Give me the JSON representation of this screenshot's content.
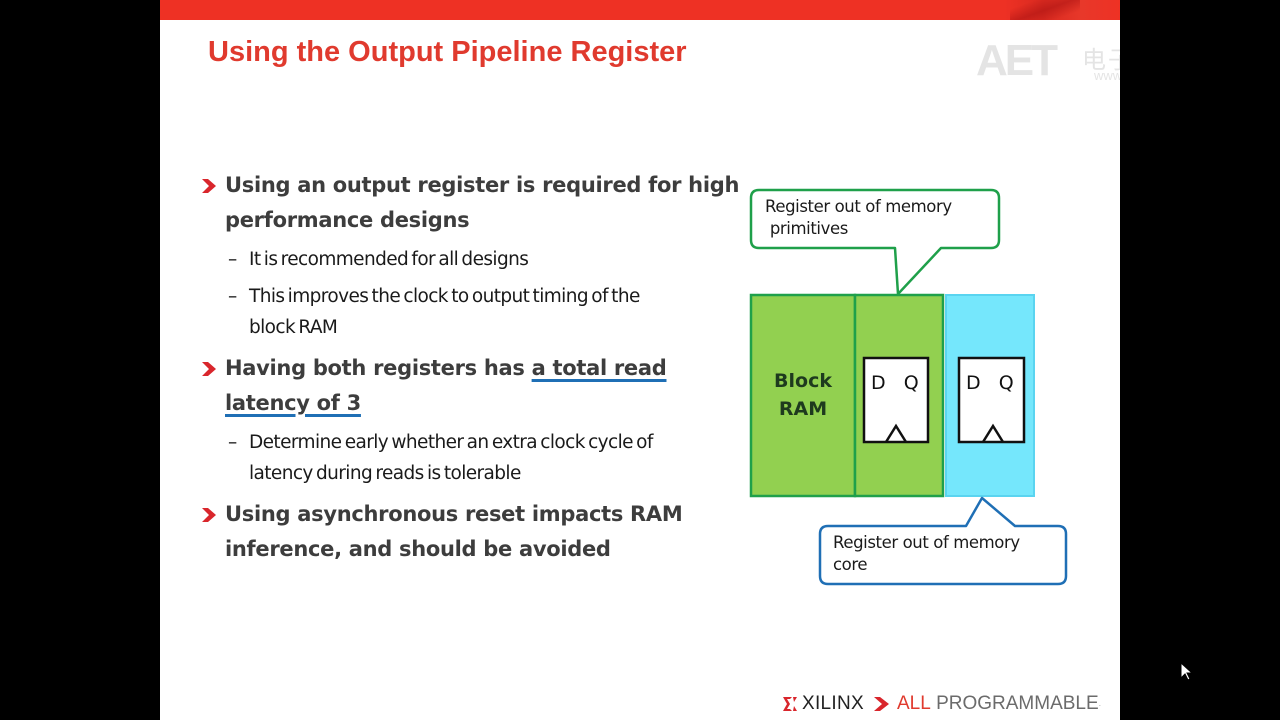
{
  "slide": {
    "title": "Using the Output Pipeline Register",
    "brand_color": "#ee3124",
    "watermark": {
      "logo": "AET",
      "chinese": "电子技术应用",
      "url": "www.ChinaAET.com"
    },
    "bullets": [
      {
        "text": "Using an output register is required for high performance designs",
        "line1": "Using an output register is required for high",
        "line2": "performance designs",
        "sub": [
          {
            "line1": "It is recommended for all designs"
          },
          {
            "line1": "This improves the clock to output timing of the",
            "line2": "block RAM"
          }
        ]
      },
      {
        "prefix": "Having both registers has ",
        "underlined_line1": "a total read",
        "underlined_line2": "latency of 3",
        "sub": [
          {
            "line1": "Determine early whether an extra clock cycle of",
            "line2": "latency during reads is tolerable"
          }
        ]
      },
      {
        "line1": "Using asynchronous reset impacts RAM",
        "line2": "inference, and should be avoided"
      }
    ],
    "sub_dash": "–",
    "diagram": {
      "block_ram_line1": "Block",
      "block_ram_line2": "RAM",
      "flipflop_label": "D   Q",
      "callout_top": "Register out of memory\n primitives",
      "callout_bottom": "Register out of memory\ncore",
      "colors": {
        "ram_fill": "#92d050",
        "ram_border": "#1fa04a",
        "core_reg_fill": "#75e7fc",
        "core_reg_border": "#5ad4f0",
        "callout_top_border": "#1fa04a",
        "callout_bottom_border": "#1f6fb5"
      }
    },
    "footer": {
      "brand": "XILINX",
      "tagline_red": "ALL",
      "tagline_gray": " PROGRAMMABLE",
      "trademark": "."
    }
  }
}
